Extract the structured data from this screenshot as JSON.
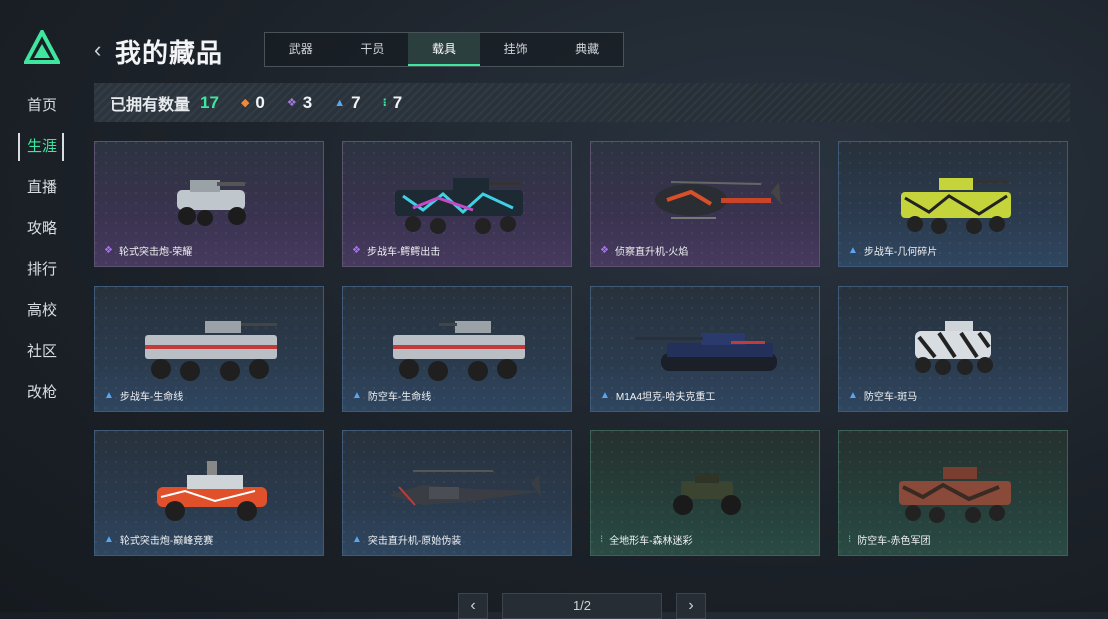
{
  "sidebar": {
    "items": [
      {
        "label": "首页"
      },
      {
        "label": "生涯"
      },
      {
        "label": "直播"
      },
      {
        "label": "攻略"
      },
      {
        "label": "排行"
      },
      {
        "label": "高校"
      },
      {
        "label": "社区"
      },
      {
        "label": "改枪"
      }
    ],
    "active_index": 1,
    "accent_color": "#3fe6a0"
  },
  "header": {
    "title": "我的藏品",
    "back_icon": "chevron-left-icon",
    "tabs": [
      {
        "label": "武器"
      },
      {
        "label": "干员"
      },
      {
        "label": "载具"
      },
      {
        "label": "挂饰"
      },
      {
        "label": "典藏"
      }
    ],
    "active_tab": 2
  },
  "stats": {
    "owned_label": "已拥有数量",
    "owned_count": "17",
    "rarities": [
      {
        "icon": "orange-diamond-icon",
        "count": "0"
      },
      {
        "icon": "purple-diamond-icon",
        "count": "3"
      },
      {
        "icon": "blue-triangle-icon",
        "count": "7"
      },
      {
        "icon": "green-dots-icon",
        "count": "7"
      }
    ]
  },
  "cards": [
    {
      "name": "轮式突击炮-荣耀",
      "rarity": "purple"
    },
    {
      "name": "步战车-鳄鳄出击",
      "rarity": "purple"
    },
    {
      "name": "侦察直升机-火焰",
      "rarity": "purple"
    },
    {
      "name": "步战车-几何碎片",
      "rarity": "blue"
    },
    {
      "name": "步战车-生命线",
      "rarity": "blue"
    },
    {
      "name": "防空车-生命线",
      "rarity": "blue"
    },
    {
      "name": "M1A4坦克-哈夫克重工",
      "rarity": "blue"
    },
    {
      "name": "防空车-斑马",
      "rarity": "blue"
    },
    {
      "name": "轮式突击炮-巅峰竞赛",
      "rarity": "blue"
    },
    {
      "name": "突击直升机-原始伪装",
      "rarity": "blue"
    },
    {
      "name": "全地形车-森林迷彩",
      "rarity": "green"
    },
    {
      "name": "防空车-赤色军团",
      "rarity": "green"
    }
  ],
  "pager": {
    "text": "1/2",
    "prev_icon": "chevron-left-icon",
    "next_icon": "chevron-right-icon"
  }
}
